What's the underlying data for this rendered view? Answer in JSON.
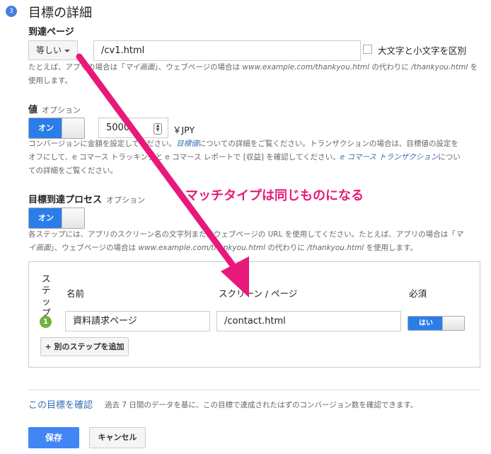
{
  "section": {
    "step_number": "3",
    "title": "目標の詳細"
  },
  "destination": {
    "label": "到達ページ",
    "match_type": "等しい",
    "value": "/cv1.html",
    "case_sensitive_label": "大文字と小文字を区別",
    "help_line1_a": "たとえば、アプリの場合は「",
    "help_line1_app": "マイ画面",
    "help_line1_b": "」、ウェブページの場合は ",
    "help_line1_url": "www.example.com/thankyou.html",
    "help_line1_c": " の代わりに ",
    "help_line1_path": "/thankyou.html",
    "help_line1_d": " を",
    "help_line2": "使用します。"
  },
  "value": {
    "label": "値",
    "optional": "オプション",
    "toggle_label": "オン",
    "amount": "5000",
    "currency": "￥JPY",
    "help_a": "コンバージョンに金額を設定してください。",
    "help_link1": "目標値",
    "help_b": "についての詳細をご覧ください。トランザクションの場合は、目標値の設定を",
    "help_c": "オフにして、e コマース トラッキングと e コマース レポートで [収益] を確認してください。",
    "help_link2": "e コマース トランザクション",
    "help_d": "につい",
    "help_e": "ての詳細をご覧ください。"
  },
  "funnel": {
    "label": "目標到達プロセス",
    "optional": "オプション",
    "toggle_label": "オン",
    "help_a": "各ステップには、アプリのスクリーン名の文字列またはウェブページの URL を使用してください。たとえば、アプリの場合は「",
    "help_app1": "マ",
    "help_app2": "イ画面",
    "help_b": "」、ウェブページの場合は ",
    "help_url": "www.example.com/thankyou.html",
    "help_c": " の代わりに ",
    "help_path": "/thankyou.html",
    "help_d": " を使用します。",
    "columns": {
      "step": "ステップ",
      "name": "名前",
      "screen": "スクリーン / ページ",
      "required": "必須"
    },
    "step_chars": [
      "ス",
      "テ",
      "ッ",
      "プ"
    ],
    "row": {
      "number": "1",
      "name": "資料請求ページ",
      "screen": "/contact.html",
      "required_label": "はい"
    },
    "add_step": "+ 別のステップを追加"
  },
  "verify": {
    "link": "この目標を確認",
    "desc": "過去 7 日間のデータを基に、この目標で達成されたはずのコンバージョン数を確認できます。"
  },
  "actions": {
    "save": "保存",
    "cancel": "キャンセル"
  },
  "annotation": {
    "text": "マッチタイプは同じものになる",
    "color": "#e8197a"
  }
}
